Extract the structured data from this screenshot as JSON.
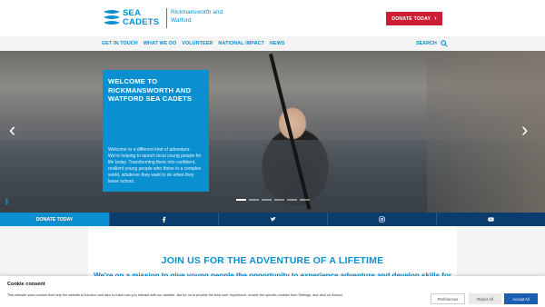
{
  "header": {
    "logo_line1": "SEA",
    "logo_line2": "CADETS",
    "unit_name": "Rickmansworth and Watford",
    "donate_label": "DONATE TODAY"
  },
  "nav": {
    "items": [
      "GET IN TOUCH",
      "WHAT WE DO",
      "VOLUNTEER",
      "NATIONAL IMPACT",
      "NEWS"
    ],
    "search_label": "SEARCH"
  },
  "hero": {
    "title": "WELCOME TO RICKMANSWORTH AND WATFORD SEA CADETS",
    "body": "Welcome to a different kind of adventure. We're helping to launch local young people for life today. Transforming them into confident, resilient young people who thrive in a complex world, whatever they want to do when they leave school."
  },
  "social_bar": {
    "donate_label": "DONATE TODAY",
    "icons": [
      "facebook-icon",
      "twitter-icon",
      "instagram-icon",
      "youtube-icon"
    ]
  },
  "main": {
    "heading": "JOIN US FOR THE ADVENTURE OF A LIFETIME",
    "subheading": "We're on a mission to give young people the opportunity to experience adventure and develop skills for life"
  },
  "cookie": {
    "title": "Cookie consent",
    "text": "This website uses cookies that help the website to function and also to track how you interact with our website. But for us to provide the best user experience, enable the specific cookies from Settings, and click on Accept.",
    "preferences_label": "Preferences",
    "reject_label": "Reject All",
    "accept_label": "Accept All"
  },
  "colors": {
    "brand_blue": "#0a8fd1",
    "donate_red": "#cc1f36",
    "navy": "#0a3c6e",
    "accept_blue": "#1b5fb3"
  }
}
